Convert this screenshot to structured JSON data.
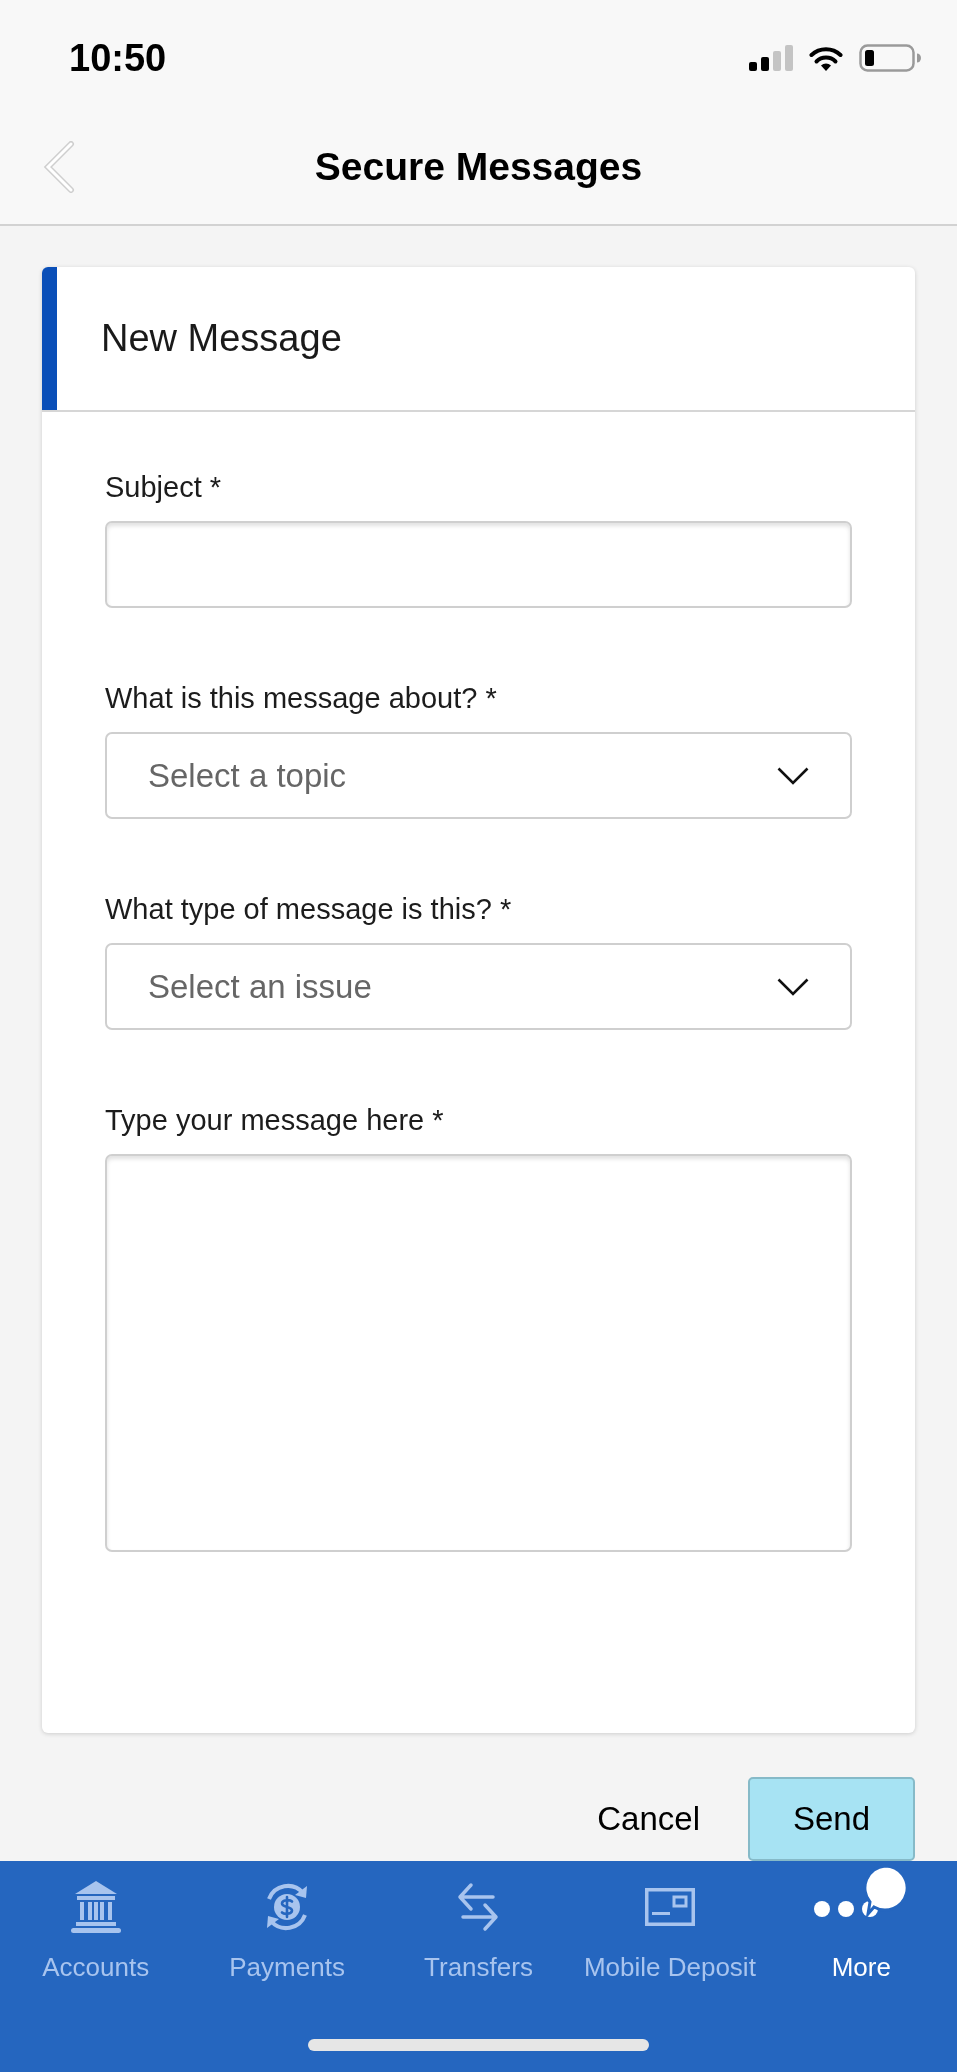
{
  "status_bar": {
    "time": "10:50"
  },
  "nav_bar": {
    "title": "Secure Messages"
  },
  "card": {
    "title": "New Message",
    "fields": [
      {
        "kind": "text",
        "label": "Subject *"
      },
      {
        "kind": "select",
        "label": "What is this message about? *",
        "placeholder": "Select a topic"
      },
      {
        "kind": "select",
        "label": "What type of message is this? *",
        "placeholder": "Select an issue"
      },
      {
        "kind": "textarea",
        "label": "Type your message here *"
      }
    ]
  },
  "actions": [
    {
      "kind": "secondary",
      "label": "Cancel"
    },
    {
      "kind": "primary",
      "label": "Send"
    }
  ],
  "tab_bar": [
    {
      "label": "Accounts",
      "selected": false
    },
    {
      "label": "Payments",
      "selected": false
    },
    {
      "label": "Transfers",
      "selected": false
    },
    {
      "label": "Mobile Deposit",
      "selected": false
    },
    {
      "label": "More",
      "selected": true
    }
  ]
}
